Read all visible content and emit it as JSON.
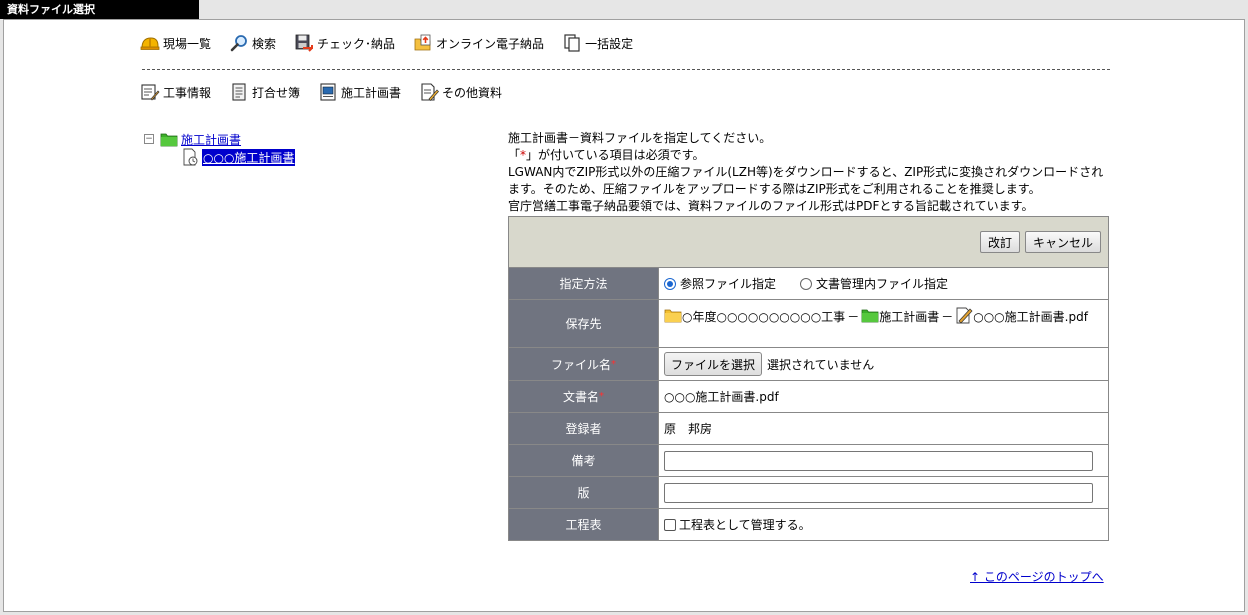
{
  "window": {
    "title": "資料ファイル選択"
  },
  "toolbar1": [
    {
      "name": "site-list",
      "icon": "helmet-icon",
      "label": "現場一覧"
    },
    {
      "name": "search",
      "icon": "magnifier-icon",
      "label": "検索"
    },
    {
      "name": "check-delivery",
      "icon": "floppy-arrow-icon",
      "label": "チェック･納品"
    },
    {
      "name": "online-delivery",
      "icon": "upload-folder-icon",
      "label": "オンライン電子納品"
    },
    {
      "name": "batch-settings",
      "icon": "copy-pages-icon",
      "label": "一括設定"
    }
  ],
  "toolbar2": [
    {
      "name": "construction-info",
      "icon": "edit-form-icon",
      "label": "工事情報"
    },
    {
      "name": "meeting-book",
      "icon": "notebook-icon",
      "label": "打合せ簿"
    },
    {
      "name": "construction-plan",
      "icon": "plan-document-icon",
      "label": "施工計画書"
    },
    {
      "name": "other-materials",
      "icon": "pencil-note-icon",
      "label": "その他資料"
    }
  ],
  "tree": {
    "toggle": "−",
    "root": {
      "label": "施工計画書",
      "icon": "green-folder-icon"
    },
    "child": {
      "label": "○○○施工計画書",
      "icon": "document-edit-icon"
    }
  },
  "instructions": {
    "line1": "施工計画書－資料ファイルを指定してください。",
    "line2_open": "「",
    "line2_mark": "*",
    "line2_rest": "」が付いている項目は必須です。",
    "line3": "LGWAN内でZIP形式以外の圧縮ファイル(LZH等)をダウンロードすると、ZIP形式に変換されダウンロードされます。そのため、圧縮ファイルをアップロードする際はZIP形式をご利用されることを推奨します。",
    "line4": "官庁営繕工事電子納品要領では、資料ファイルのファイル形式はPDFとする旨記載されています。"
  },
  "buttons": {
    "revise": "改訂",
    "cancel": "キャンセル"
  },
  "form": {
    "method": {
      "label": "指定方法",
      "option1": "参照ファイル指定",
      "option2": "文書管理内ファイル指定",
      "selected": "option1"
    },
    "location": {
      "label": "保存先",
      "part1": "○年度○○○○○○○○○○工事",
      "sep1": "－",
      "part2": "施工計画書",
      "sep2": "－",
      "part3": "○○○施工計画書.pdf"
    },
    "filename": {
      "label": "ファイル名",
      "required": "*",
      "button": "ファイルを選択",
      "status": "選択されていません"
    },
    "docname": {
      "label": "文書名",
      "required": "*",
      "value": "○○○施工計画書.pdf"
    },
    "registrant": {
      "label": "登録者",
      "value": "原　邦房"
    },
    "remarks": {
      "label": "備考",
      "value": ""
    },
    "edition": {
      "label": "版",
      "value": ""
    },
    "schedule": {
      "label": "工程表",
      "checkbox_label": "工程表として管理する。",
      "checked": false
    }
  },
  "footer": {
    "top_link": "↑ このページのトップへ"
  },
  "colors": {
    "label_bg": "#707480",
    "header_bg": "#d8d8cc",
    "link": "#0000cc",
    "required": "#ff3030"
  }
}
